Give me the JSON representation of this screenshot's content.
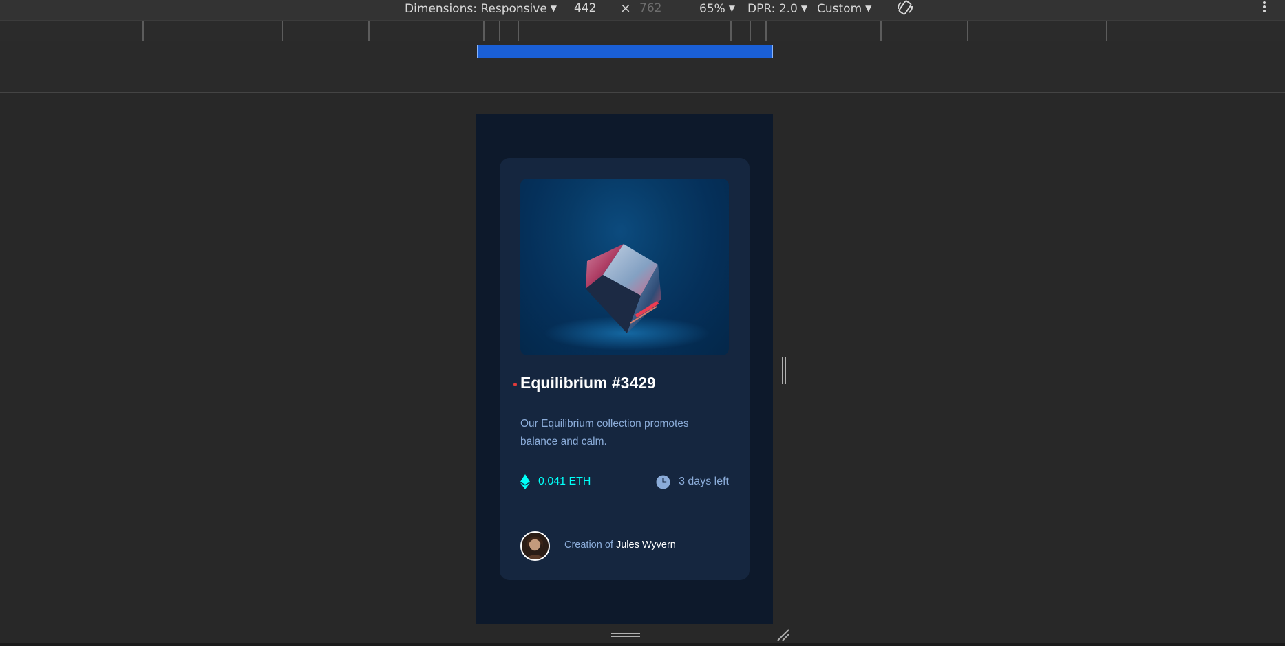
{
  "toolbar": {
    "dimensions_label": "Dimensions: Responsive",
    "width_value": "442",
    "times": "×",
    "height_placeholder": "762",
    "zoom": "65%",
    "dpr": "DPR: 2.0",
    "throttle": "Custom",
    "icons": {
      "rotate": "rotate-icon",
      "more": "more-vert-icon",
      "caret": "triangle-down-icon"
    }
  },
  "card": {
    "title": "Equilibrium #3429",
    "description": "Our Equilibrium collection promotes balance and calm.",
    "price": "0.041 ETH",
    "time_left": "3 days left",
    "creator_prefix": "Creation of ",
    "creator_name": "Jules Wyvern",
    "icons": {
      "eth": "ethereum-icon",
      "clock": "clock-icon",
      "image": "cube-image",
      "avatar": "avatar-photo"
    }
  },
  "colors": {
    "page_bg": "#0d192b",
    "card_bg": "#15263f",
    "cyan": "#00fff8",
    "soft_blue": "#8bacd9",
    "white": "#ffffff",
    "devtools_bg": "#282828",
    "ruler_blue": "#1a5fd6"
  }
}
